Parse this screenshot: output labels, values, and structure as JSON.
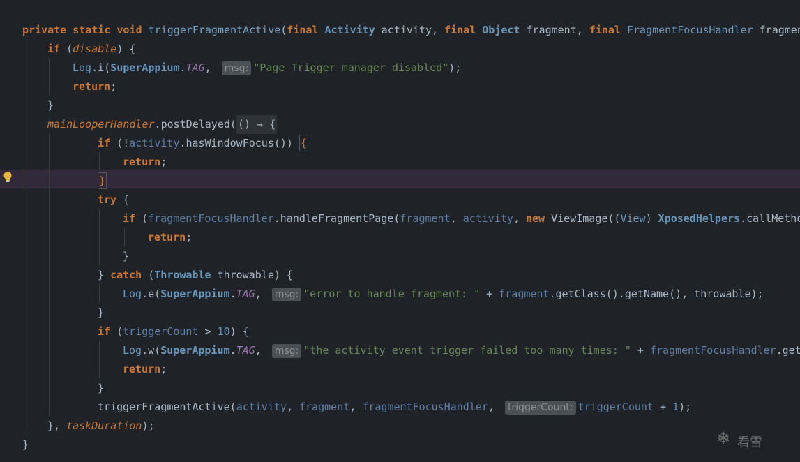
{
  "editor": {
    "language": "java",
    "lines": [
      "private static void triggerFragmentActive(final Activity activity, final Object fragment, final FragmentFocusHandler fragmen",
      "    if (disable) {",
      "        Log.i(SuperAppium.TAG, msg: \"Page Trigger manager disabled\");",
      "        return;",
      "    }",
      "    mainLooperHandler.postDelayed(() → {",
      "            if (!activity.hasWindowFocus()) {",
      "                return;",
      "            }",
      "            try {",
      "                if (fragmentFocusHandler.handleFragmentPage(fragment, activity, new ViewImage((View) XposedHelpers.callMetho",
      "                    return;",
      "                }",
      "            } catch (Throwable throwable) {",
      "                Log.e(SuperAppium.TAG, msg: \"error to handle fragment: \" + fragment.getClass().getName(), throwable);",
      "            }",
      "            if (triggerCount > 10) {",
      "                Log.w(SuperAppium.TAG, msg: \"the activity event trigger failed too many times: \" + fragmentFocusHandler.getC",
      "                return;",
      "            }",
      "            triggerFragmentActive(activity, fragment, fragmentFocusHandler, triggerCount: triggerCount + 1);",
      "    }, taskDuration);",
      "}"
    ],
    "tokens": {
      "private": "private",
      "static": "static",
      "void": "void",
      "method": "triggerFragmentActive",
      "final": "final",
      "Activity": "Activity",
      "activity": "activity",
      "Object": "Object",
      "fragment": "fragment",
      "FragmentFocusHandler": "FragmentFocusHandler",
      "fragmen": "fragmen",
      "if": "if",
      "disable": "disable",
      "Log": "Log",
      "i": "i",
      "e": "e",
      "w": "w",
      "SuperAppium": "SuperAppium",
      "TAG": "TAG",
      "msg": "msg:",
      "str1": "\"Page Trigger manager disabled\"",
      "return": "return",
      "mainLooperHandler": "mainLooperHandler",
      "postDelayed": "postDelayed",
      "lambda": "() → {",
      "hasWindowFocus": "hasWindowFocus",
      "try": "try",
      "fragmentFocusHandler": "fragmentFocusHandler",
      "handleFragmentPage": "handleFragmentPage",
      "new": "new",
      "ViewImage": "ViewImage",
      "View": "View",
      "XposedHelpers": "XposedHelpers",
      "callMetho": "callMetho",
      "catch": "catch",
      "Throwable": "Throwable",
      "throwable": "throwable",
      "str2": "\"error to handle fragment: \"",
      "getClass": "getClass",
      "getName": "getName",
      "triggerCount": "triggerCount",
      "ten": "10",
      "str3": "\"the activity event trigger failed too many times: \"",
      "getC": "getC",
      "triggerCountHint": "triggerCount:",
      "one": "1",
      "taskDuration": "taskDuration"
    }
  },
  "watermark": {
    "label": "看雪",
    "icon": "snowflake-icon"
  },
  "gutter": {
    "icon": "lightbulb-icon"
  },
  "colors": {
    "background": "#1f2328",
    "keyword": "#cc7832",
    "type": "#6897bb",
    "string": "#6a8759",
    "field": "#9876aa",
    "highlight": "#32293a"
  }
}
